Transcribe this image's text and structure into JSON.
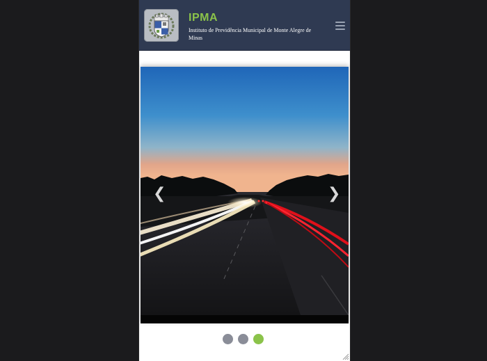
{
  "header": {
    "title": "IPMA",
    "subtitle": "Instituto de Previdência Municipal de Monte Alegre de Minas",
    "logo_icon": "municipal-coat-of-arms",
    "menu_icon": "hamburger-menu-icon"
  },
  "slider": {
    "prev_label": "❮",
    "next_label": "❯",
    "slide_count": 3,
    "active_slide": 3,
    "dot_color": "#8a8d98",
    "active_dot_color": "#8bc34a"
  },
  "colors": {
    "header_bg": "#2f3a52",
    "brand_green": "#8bc34a",
    "page_bg": "#1b1b1d"
  }
}
